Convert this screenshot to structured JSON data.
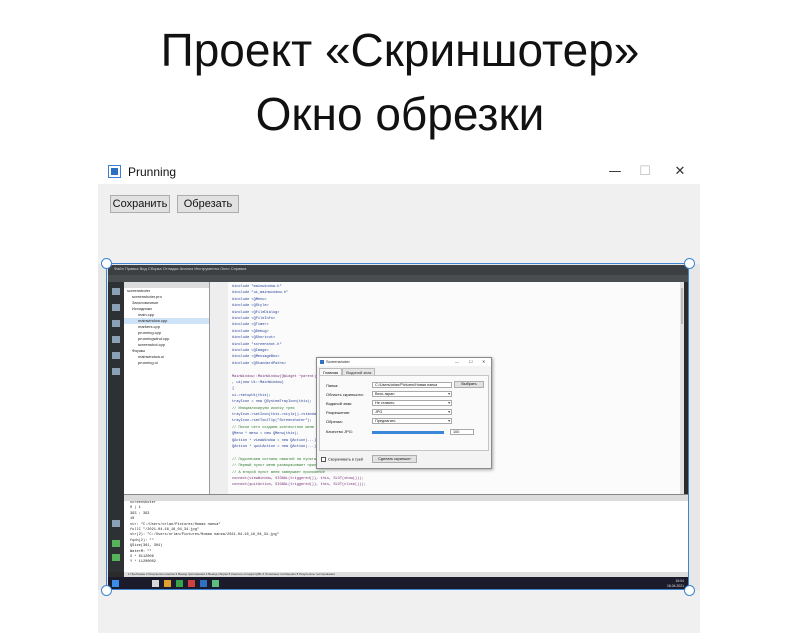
{
  "slide": {
    "title_line1": "Проект «Скриншотер»",
    "title_line2": "Окно обрезки"
  },
  "window": {
    "title": "Prunning",
    "controls": {
      "minimize": "—",
      "maximize": "☐",
      "close": "✕"
    }
  },
  "toolbar": {
    "save_label": "Сохранить",
    "crop_label": "Обрезать"
  },
  "screenshot": {
    "ide_menu": "Файл  Правка  Вид  Сборка  Отладка  Анализ  Инструменты  Окно  Справка",
    "project_tree": [
      "screenshoter",
      "screenshoter.pro",
      "Заголовочные",
      "Исходники",
      "main.cpp",
      "mainwindow.cpp",
      "markers.cpp",
      "prunning.cpp",
      "prunningwind.cpp",
      "screenshot.cpp",
      "Формы",
      "mainwindow.ui",
      "prunning.ui"
    ],
    "code_lines": [
      "#include \"mainwindow.h\"",
      "#include \"ui_mainwindow.h\"",
      "#include <QMenu>",
      "#include <QStyle>",
      "#include <QFileDialog>",
      "#include <QFileInfo>",
      "#include <QTimer>",
      "#include <QDebug>",
      "#include <QShortcut>",
      "#include \"screenshot.h\"",
      "#include <QImage>",
      "#include <QMessageBox>",
      "#include <QStandardPaths>",
      "",
      "MainWindow::MainWindow(QWidget *parent)",
      "    , ui(new Ui::MainWindow)",
      "{",
      "    ui->setupUi(this);",
      "    trayIcon = new QSystemTrayIcon(this);",
      "    // Инициализируем иконку трея",
      "    trayIcon->setIcon(this->style()->standardIcon(...));",
      "    trayIcon->setToolTip(\"Screenshoter\");",
      "    // После чего создаем контекстное меню",
      "    QMenu * menu = new QMenu(this);",
      "    QAction * viewWindow = new QAction(...);",
      "    QAction * quitAction = new QAction(...);",
      "",
      "    // Подключаем сигналы нажатий на пункты меню",
      "    // Первый пункт меню разворачивает приложение",
      "    // А второй пункт меню завершает приложение",
      "    connect(viewWindow, SIGNAL(triggered()), this, SLOT(show()));",
      "    connect(quitAction, SIGNAL(triggered()), this, SLOT(close()));"
    ],
    "output_lines": [
      "screenshoter",
      "0  |  1",
      "393  :  393",
      "10",
      "str: \"C:/Users/orlan/Pictures/Новая папка\"",
      "fullC \"/2021-04-16_18_04_34.jpg\"",
      "str(2): \"C:/Users/orlan/Pictures/Новая папка/2021-04-16_18_04_34.jpg\"",
      "fqdn(2): \"\"",
      "QSize(361, 304)",
      "WaterM: \"\"",
      "X *  6112006",
      "Y *  11200002"
    ],
    "status_text": "1 Проблемы   2 Результаты поиска   3 Вывод приложения   4 Вывод сборки   5 Консоль отладки QML   6 Основные сообщения   8 Результаты тестирования",
    "clock": [
      "15:04",
      "16.04.2021"
    ],
    "dialog": {
      "title": "Screenshoter",
      "tabs": [
        "Главная",
        "Водяной знак"
      ],
      "folder_label": "Папка:",
      "folder_value": "C:/Users/orlan/Pictures/Новая папка",
      "browse_label": "Выбрать",
      "area_label": "Область скриншота:",
      "area_value": "Весь экран",
      "watermark_label": "Водяной знак:",
      "watermark_value": "Не ставить",
      "resolution_label": "Разрешение:",
      "resolution_value": "JPG",
      "crop_label": "Обрезка:",
      "crop_value": "Предлагать",
      "quality_label": "Качество JPG:",
      "quality_value": "100",
      "tray_label": "Сворачивать в трей",
      "take_label": "Сделать скриншот"
    }
  },
  "colors": {
    "selection": "#3d86d4",
    "window_bg": "#f0f0f0"
  }
}
